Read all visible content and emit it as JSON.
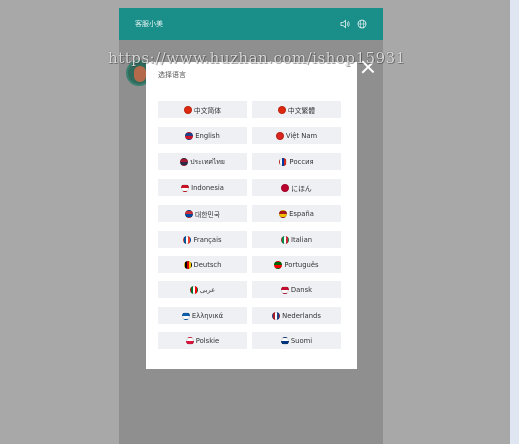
{
  "app": {
    "title": "客服小美"
  },
  "watermark": "https://www.huzhan.com/ishop15931",
  "dialog": {
    "title": "选择语言",
    "languages": [
      {
        "label": "中文简体",
        "flag": "cn-flag-icon",
        "colors": [
          "#de2910"
        ]
      },
      {
        "label": "中文繁體",
        "flag": "hk-flag-icon",
        "colors": [
          "#de2910"
        ]
      },
      {
        "label": "English",
        "flag": "uk-flag-icon",
        "colors": [
          "#1f3f8a",
          "#cf142b"
        ]
      },
      {
        "label": "Việt Nam",
        "flag": "vn-flag-icon",
        "colors": [
          "#da251d"
        ]
      },
      {
        "label": "ประเทศไทย",
        "flag": "th-flag-icon",
        "colors": [
          "#a51931",
          "#2d2a4a"
        ]
      },
      {
        "label": "Россия",
        "flag": "ru-flag-icon",
        "colors": [
          "#ffffff",
          "#0039a6",
          "#d52b1e"
        ]
      },
      {
        "label": "Indonesia",
        "flag": "id-flag-icon",
        "colors": [
          "#ce1126",
          "#ffffff"
        ]
      },
      {
        "label": "にほん",
        "flag": "jp-flag-icon",
        "colors": [
          "#bc002d"
        ]
      },
      {
        "label": "대한민국",
        "flag": "kr-flag-icon",
        "colors": [
          "#cd2e3a",
          "#0047a0"
        ]
      },
      {
        "label": "España",
        "flag": "es-flag-icon",
        "colors": [
          "#aa151b",
          "#f1bf00"
        ]
      },
      {
        "label": "Français",
        "flag": "fr-flag-icon",
        "colors": [
          "#0055a4",
          "#ffffff",
          "#ef4135"
        ]
      },
      {
        "label": "Italian",
        "flag": "it-flag-icon",
        "colors": [
          "#009246",
          "#ffffff",
          "#ce2b37"
        ]
      },
      {
        "label": "Deutsch",
        "flag": "de-flag-icon",
        "colors": [
          "#000000",
          "#dd0000",
          "#ffce00"
        ]
      },
      {
        "label": "Português",
        "flag": "pt-flag-icon",
        "colors": [
          "#006600",
          "#ff0000"
        ]
      },
      {
        "label": "عربى",
        "flag": "ae-flag-icon",
        "colors": [
          "#00732f",
          "#ffffff",
          "#ff0000"
        ]
      },
      {
        "label": "Dansk",
        "flag": "dk-flag-icon",
        "colors": [
          "#c60c30",
          "#ffffff"
        ]
      },
      {
        "label": "Ελληνικά",
        "flag": "gr-flag-icon",
        "colors": [
          "#0d5eaf",
          "#ffffff"
        ]
      },
      {
        "label": "Nederlands",
        "flag": "nl-flag-icon",
        "colors": [
          "#ae1c28",
          "#ffffff",
          "#21468b"
        ]
      },
      {
        "label": "Polskie",
        "flag": "pl-flag-icon",
        "colors": [
          "#ffffff",
          "#dc143c"
        ]
      },
      {
        "label": "Suomi",
        "flag": "fi-flag-icon",
        "colors": [
          "#ffffff",
          "#003580"
        ]
      }
    ]
  }
}
